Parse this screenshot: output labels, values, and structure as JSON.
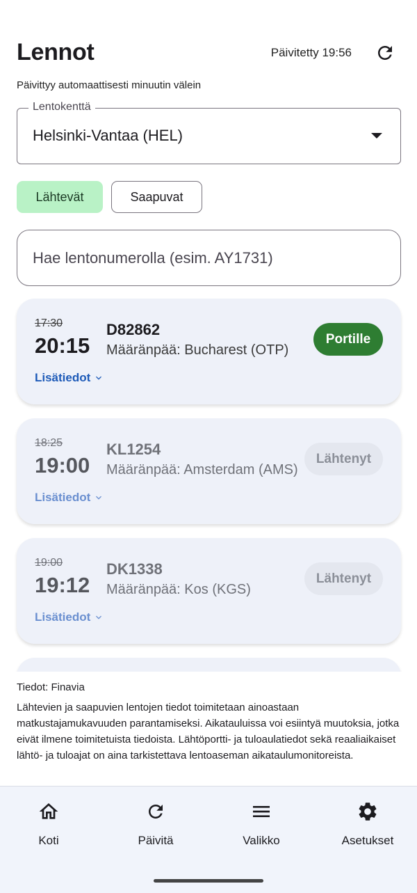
{
  "header": {
    "title": "Lennot",
    "updated_text": "Päivitetty 19:56",
    "subtitle": "Päivittyy automaattisesti minuutin välein"
  },
  "airport": {
    "label": "Lentokenttä",
    "value": "Helsinki-Vantaa (HEL)"
  },
  "tabs": {
    "departures": "Lähtevät",
    "arrivals": "Saapuvat",
    "selected": "Lähtevät"
  },
  "search": {
    "placeholder": "Hae lentonumerolla (esim. AY1731)"
  },
  "flights": [
    {
      "scheduled": "17:30",
      "actual": "20:15",
      "flight_number": "D82862",
      "destination": "Määränpää: Bucharest (OTP)",
      "status": "Portille",
      "details": "Lisätiedot"
    },
    {
      "scheduled": "18:25",
      "actual": "19:00",
      "flight_number": "KL1254",
      "destination": "Määränpää: Amsterdam (AMS)",
      "status": "Lähtenyt",
      "details": "Lisätiedot"
    },
    {
      "scheduled": "19:00",
      "actual": "19:12",
      "flight_number": "DK1338",
      "destination": "Määränpää: Kos (KGS)",
      "status": "Lähtenyt",
      "details": "Lisätiedot"
    }
  ],
  "footer": {
    "source": "Tiedot: Finavia",
    "disclaimer": "Lähtevien ja saapuvien lentojen tiedot toimitetaan ainoastaan matkustajamukavuuden parantamiseksi. Aikatauluissa voi esiintyä muutoksia, jotka eivät ilmene toimitetuista tiedoista. Lähtöportti- ja tuloaulatiedot sekä reaaliaikaiset lähtö- ja tuloajat on aina tarkistettava lentoaseman aikataulumonitoreista."
  },
  "nav": [
    {
      "label": "Koti",
      "icon": "home-icon"
    },
    {
      "label": "Päivitä",
      "icon": "refresh-icon"
    },
    {
      "label": "Valikko",
      "icon": "menu-icon"
    },
    {
      "label": "Asetukset",
      "icon": "gear-icon"
    }
  ],
  "colors": {
    "status_gate": "#2e7d32",
    "status_departed": "#e4e7ef",
    "selected_chip": "#b9f2c6",
    "link": "#1d5ab8",
    "card_bg": "#eef1f9"
  }
}
